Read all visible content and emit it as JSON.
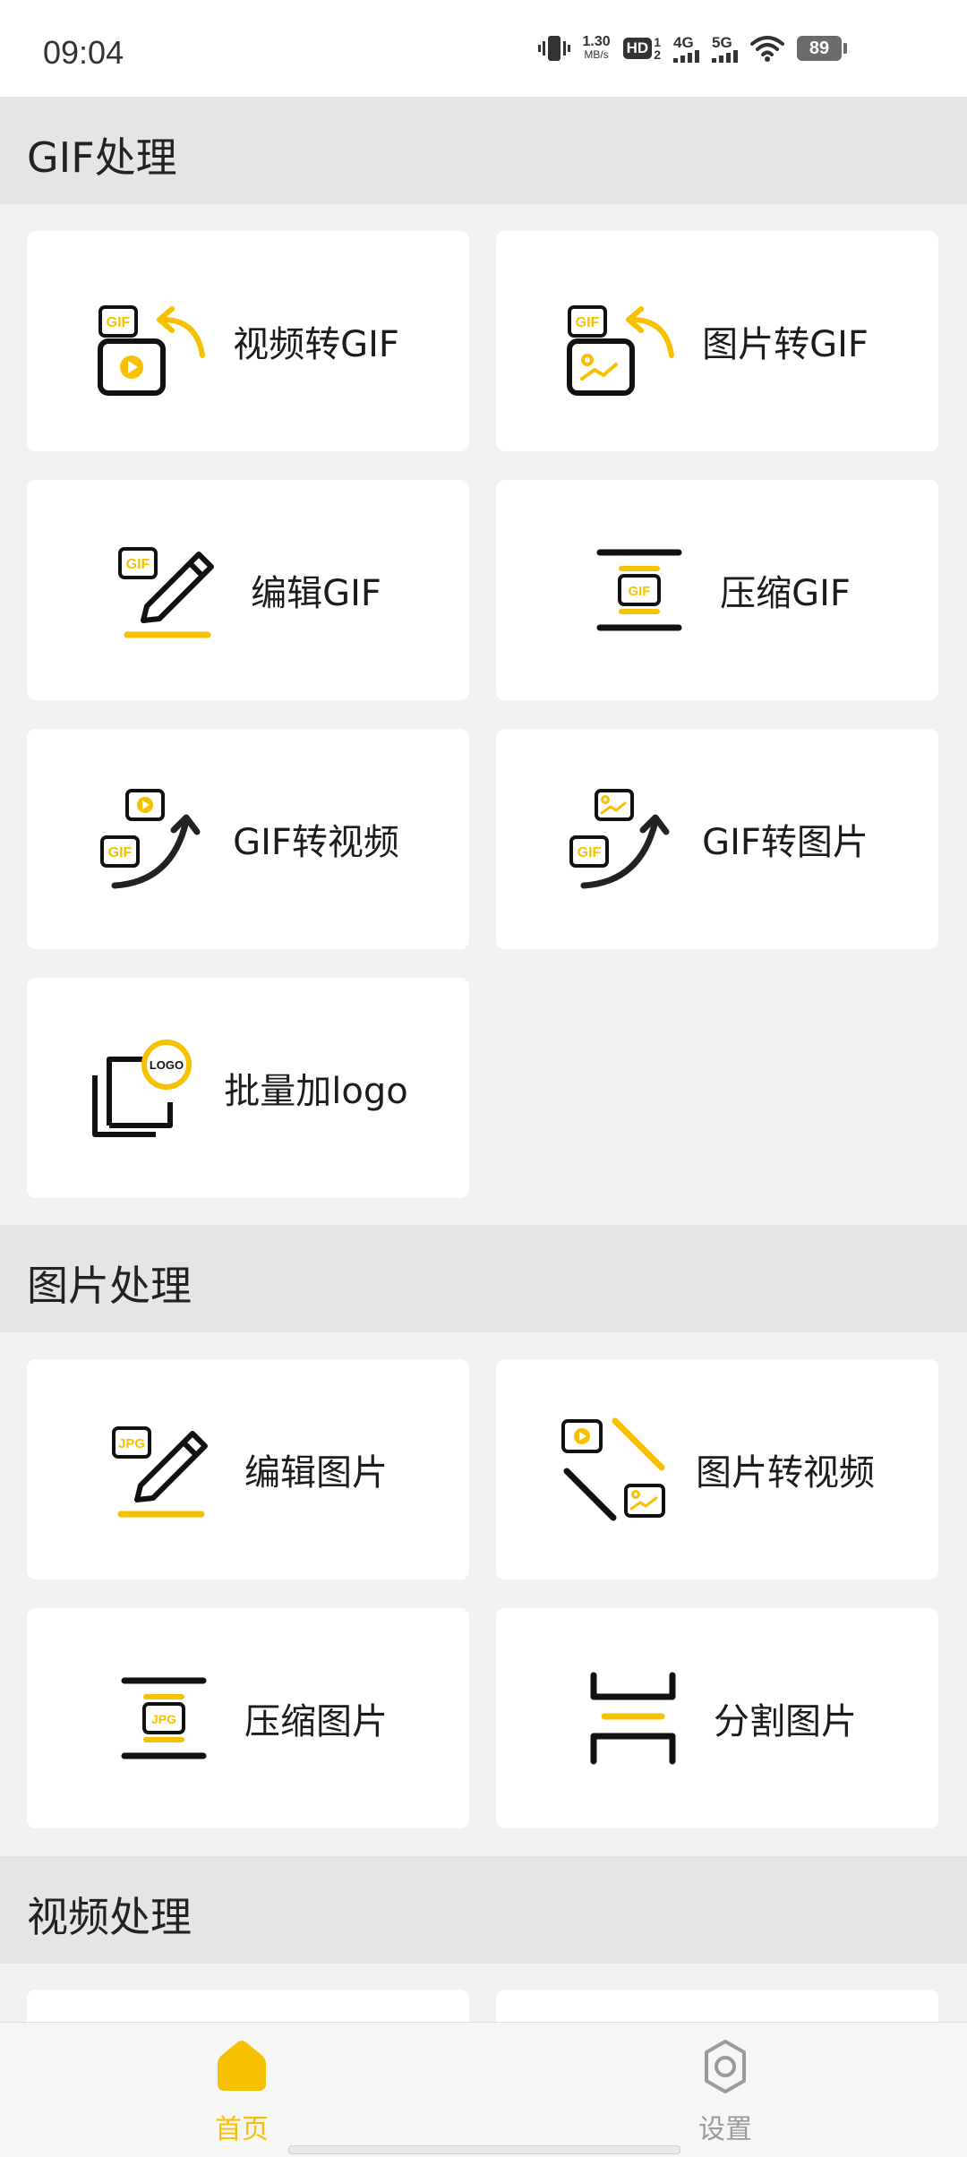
{
  "status_bar": {
    "time": "09:04",
    "net_speed_value": "1.30",
    "net_speed_unit": "MB/s",
    "hd_label": "HD",
    "hd_sub_top": "1",
    "hd_sub_bottom": "2",
    "net_4g": "4G",
    "net_5g": "5G",
    "battery": "89"
  },
  "sections": {
    "gif": {
      "title": "GIF处理",
      "items": [
        {
          "label": "视频转GIF",
          "icon": "video-to-gif-icon"
        },
        {
          "label": "图片转GIF",
          "icon": "image-to-gif-icon"
        },
        {
          "label": "编辑GIF",
          "icon": "edit-gif-icon"
        },
        {
          "label": "压缩GIF",
          "icon": "compress-gif-icon"
        },
        {
          "label": "GIF转视频",
          "icon": "gif-to-video-icon"
        },
        {
          "label": "GIF转图片",
          "icon": "gif-to-image-icon"
        },
        {
          "label": "批量加logo",
          "icon": "batch-logo-icon"
        }
      ]
    },
    "image": {
      "title": "图片处理",
      "items": [
        {
          "label": "编辑图片",
          "icon": "edit-image-icon"
        },
        {
          "label": "图片转视频",
          "icon": "image-to-video-icon"
        },
        {
          "label": "压缩图片",
          "icon": "compress-image-icon"
        },
        {
          "label": "分割图片",
          "icon": "split-image-icon"
        }
      ]
    },
    "video": {
      "title": "视频处理"
    }
  },
  "icon_text": {
    "gif": "GIF",
    "jpg": "JPG",
    "logo": "LOGO"
  },
  "bottom_nav": {
    "home_label": "首页",
    "settings_label": "设置"
  },
  "colors": {
    "accent": "#f7c000",
    "ink": "#111111",
    "inactive": "#9a9a9a"
  }
}
